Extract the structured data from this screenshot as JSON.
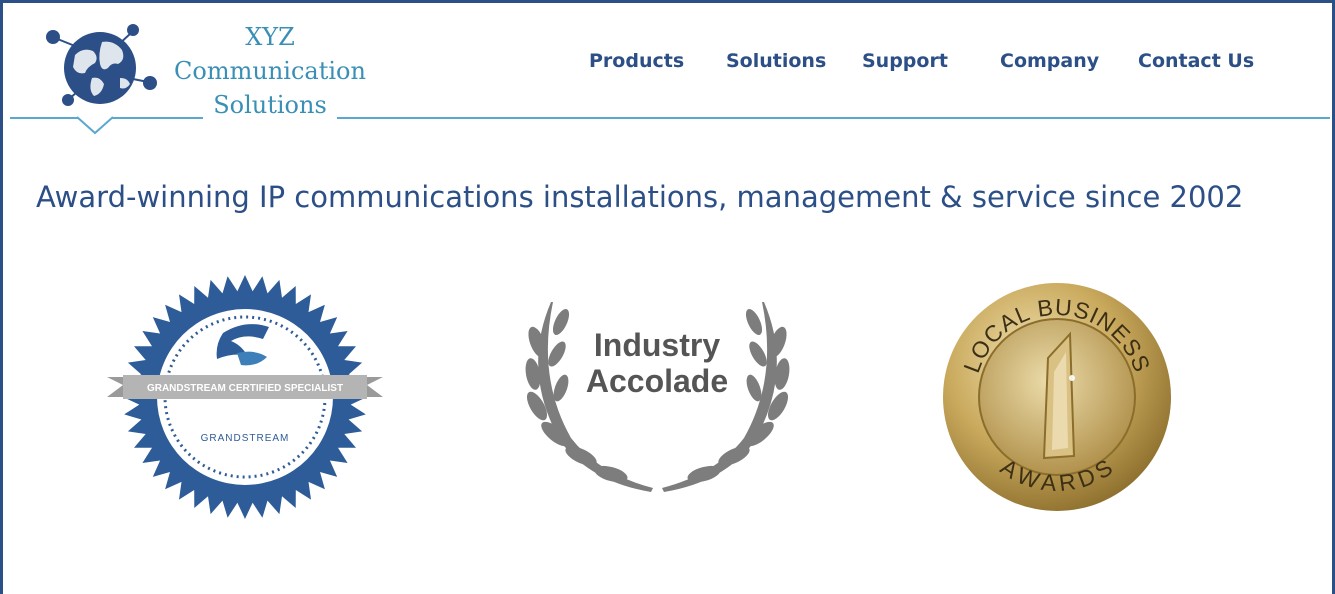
{
  "logo": {
    "line1": "XYZ",
    "line2": "Communication",
    "line3": "Solutions"
  },
  "nav": [
    "Products",
    "Solutions",
    "Support",
    "Company",
    "Contact Us"
  ],
  "tagline": "Award-winning IP communications installations, management & service since 2002",
  "badges": {
    "grandstream": {
      "ribbon": "GRANDSTREAM CERTIFIED SPECIALIST",
      "brand": "GRANDSTREAM"
    },
    "accolade": {
      "line1": "Industry",
      "line2": "Accolade"
    },
    "local": {
      "top": "LOCAL BUSINESS",
      "bottom": "AWARDS"
    }
  },
  "colors": {
    "brand_blue": "#2b4f86",
    "logo_teal": "#3a8fb5",
    "badge_blue": "#2d5c98",
    "gold": "#c9a95c"
  }
}
